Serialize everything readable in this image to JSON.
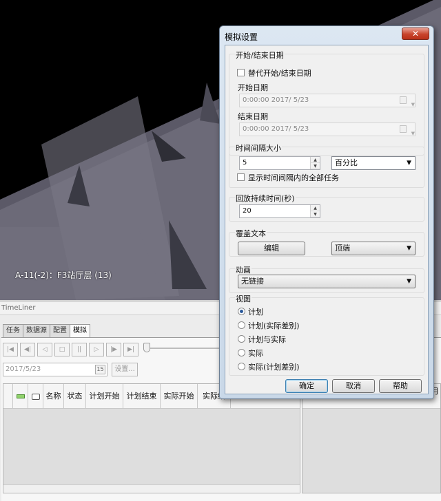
{
  "viewport": {
    "label": "A-11(-2)：F3站厅层 (13)"
  },
  "timeliner": {
    "title": "TimeLiner",
    "tabs": [
      "任务",
      "数据源",
      "配置",
      "模拟"
    ],
    "active_tab": "模拟",
    "date_value": "2017/5/23",
    "settings_label": "设置...",
    "columns": [
      "名称",
      "状态",
      "计划开始",
      "计划结束",
      "实际开始",
      "实际结"
    ],
    "gantt_header_right": "月"
  },
  "dialog": {
    "title": "模拟设置",
    "close_label": "✕",
    "start_end": {
      "group_title": "开始/结束日期",
      "override_label": "替代开始/结束日期",
      "override_checked": false,
      "start_label": "开始日期",
      "start_value": "0:00:00 2017/  5/23",
      "end_label": "结束日期",
      "end_value": "0:00:00 2017/  5/23"
    },
    "interval": {
      "group_title": "时间间隔大小",
      "value": "5",
      "unit": "百分比",
      "show_all_label": "显示时间间隔内的全部任务",
      "show_all_checked": false
    },
    "playback": {
      "group_title": "回放持续时间(秒)",
      "value": "20"
    },
    "overlay": {
      "group_title": "覆盖文本",
      "edit_label": "编辑",
      "position": "顶端"
    },
    "animation": {
      "group_title": "动画",
      "value": "无链接"
    },
    "view": {
      "group_title": "视图",
      "options": [
        "计划",
        "计划(实际差别)",
        "计划与实际",
        "实际",
        "实际(计划差别)"
      ],
      "selected": "计划"
    },
    "buttons": {
      "ok": "确定",
      "cancel": "取消",
      "help": "帮助"
    }
  }
}
